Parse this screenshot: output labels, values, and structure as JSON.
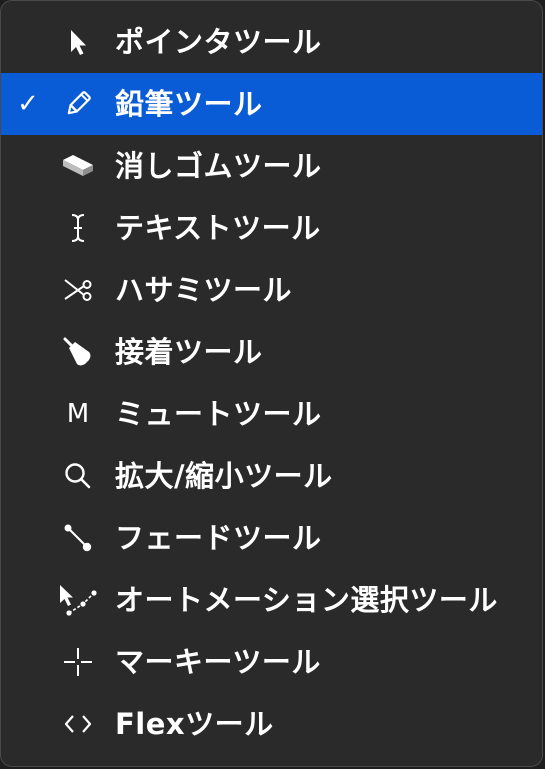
{
  "menu": {
    "items": [
      {
        "label": "ポインタツール",
        "icon": "pointer-arrow-icon",
        "selected": false
      },
      {
        "label": "鉛筆ツール",
        "icon": "pencil-icon",
        "selected": true
      },
      {
        "label": "消しゴムツール",
        "icon": "eraser-icon",
        "selected": false
      },
      {
        "label": "テキストツール",
        "icon": "text-cursor-icon",
        "selected": false
      },
      {
        "label": "ハサミツール",
        "icon": "scissors-icon",
        "selected": false
      },
      {
        "label": "接着ツール",
        "icon": "glue-icon",
        "selected": false
      },
      {
        "label": "ミュートツール",
        "icon": "mute-m-icon",
        "icon_glyph": "M",
        "selected": false
      },
      {
        "label": "拡大/縮小ツール",
        "icon": "magnifier-icon",
        "selected": false
      },
      {
        "label": "フェードツール",
        "icon": "fade-line-icon",
        "selected": false
      },
      {
        "label": "オートメーション選択ツール",
        "icon": "automation-select-icon",
        "selected": false
      },
      {
        "label": "マーキーツール",
        "icon": "marquee-crosshair-icon",
        "selected": false
      },
      {
        "label": "Flexツール",
        "icon": "flex-brackets-icon",
        "selected": false
      }
    ],
    "check_glyph": "✓",
    "colors": {
      "background": "#2a2a2a",
      "selected": "#0a5bd6",
      "text": "#ffffff"
    }
  }
}
